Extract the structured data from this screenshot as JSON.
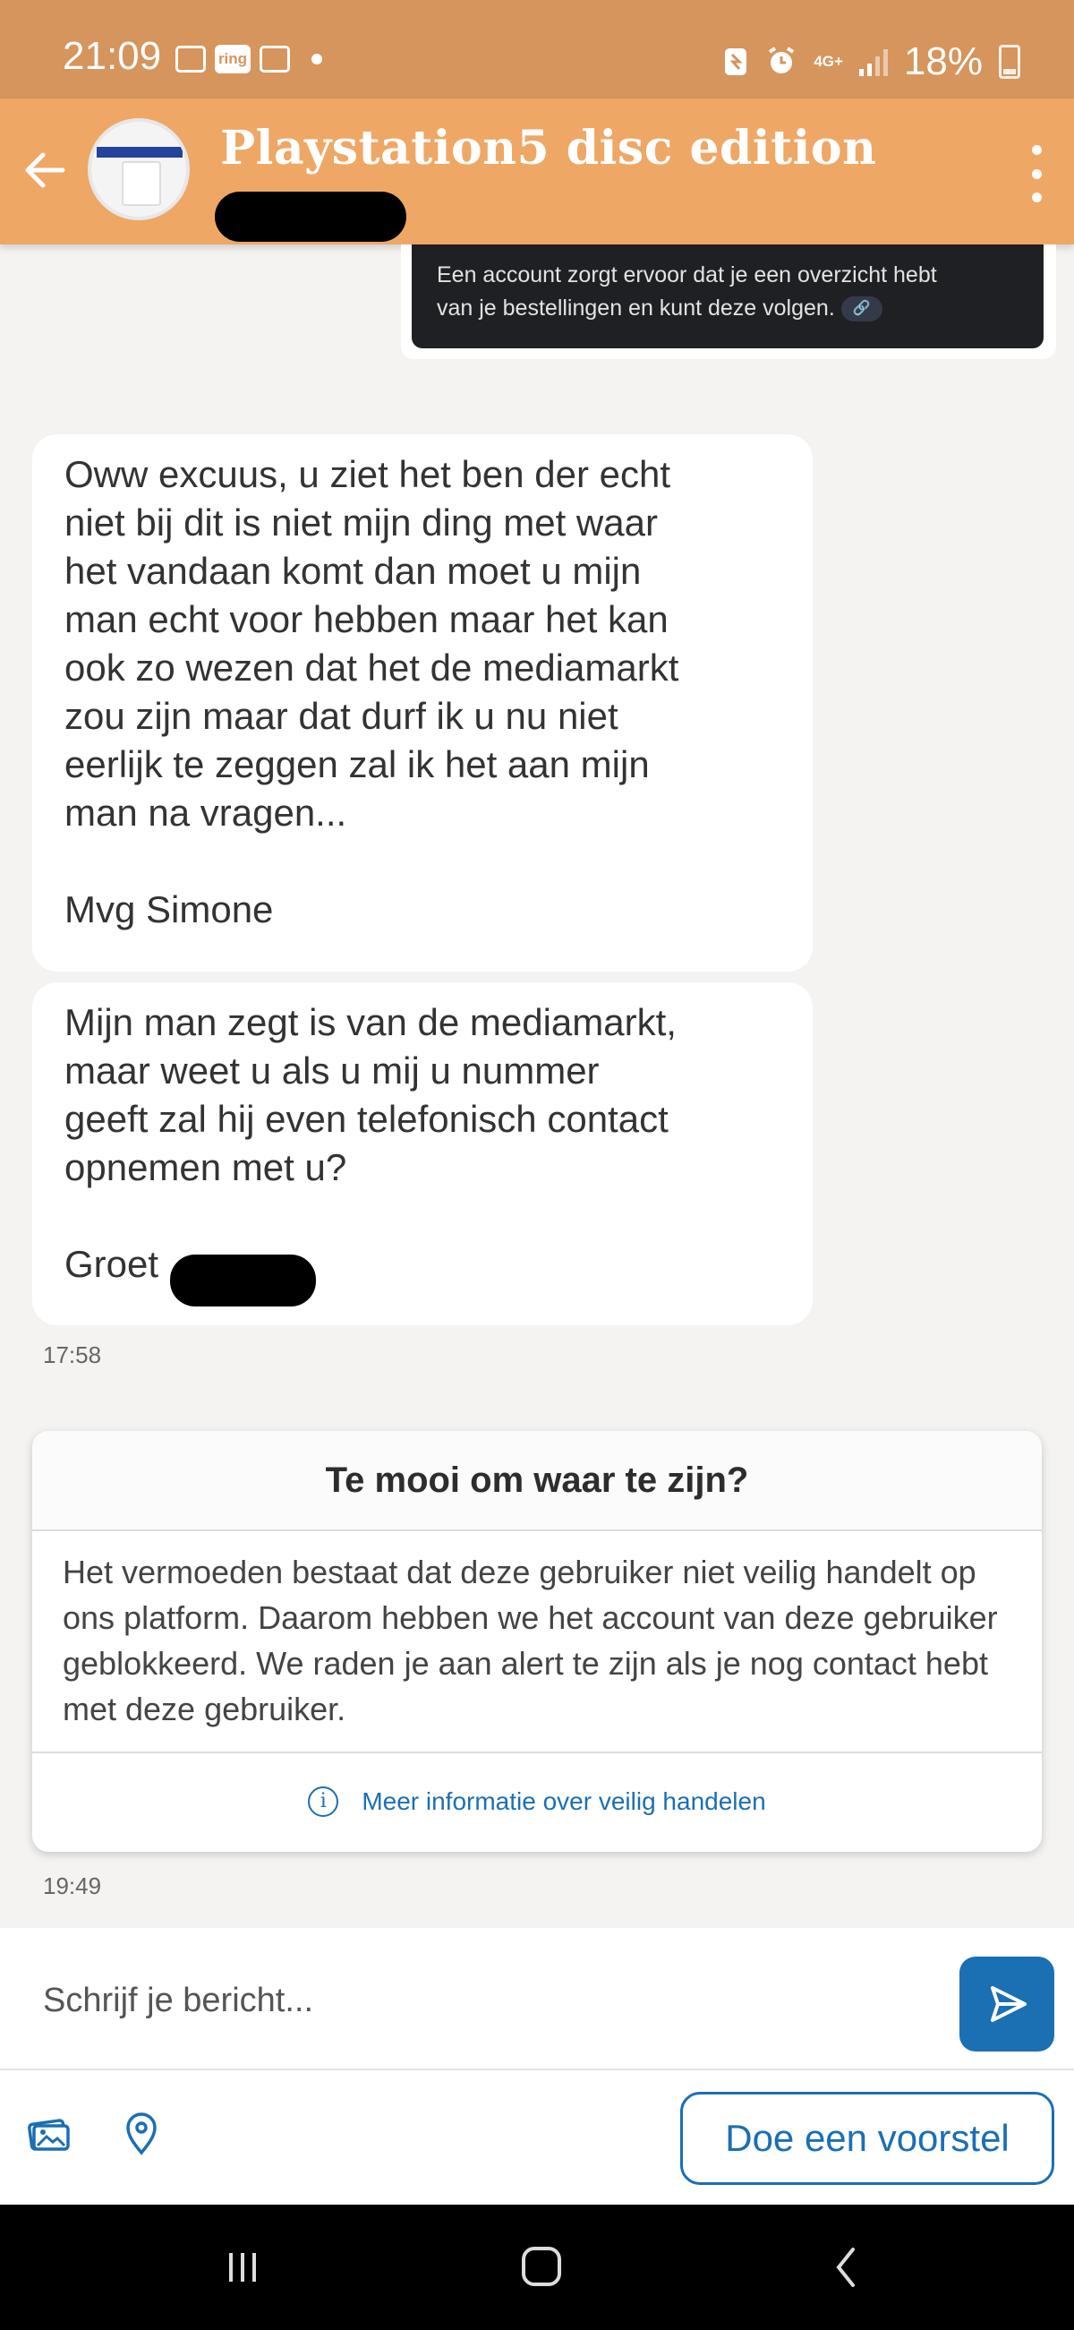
{
  "status_bar": {
    "time": "21:09",
    "left_icons": [
      "image-icon",
      "ring-icon",
      "mail-icon",
      "dot-icon"
    ],
    "ring_label": "ring",
    "network": "4G+",
    "battery": "18%",
    "right_icons": [
      "nfc-icon",
      "alarm-icon",
      "network-4g-icon",
      "signal-icon",
      "battery-icon"
    ]
  },
  "header": {
    "title": "Playstation5 disc edition",
    "back_icon": "arrow-left-icon",
    "menu_icon": "more-vertical-icon"
  },
  "conversation": {
    "own_message": {
      "text": "Een account zorgt ervoor dat je een overzicht hebt\nvan je bestellingen en kunt deze volgen."
    },
    "incoming": [
      {
        "text": "Oww excuus, u ziet het ben der echt\nniet bij dit is niet mijn ding met waar\nhet vandaan komt dan moet u mijn\nman echt voor hebben maar het kan\nook zo wezen dat het de mediamarkt\nzou zijn maar dat durf ik u nu niet\neerlijk te zeggen zal ik het aan mijn\nman na vragen...\n\nMvg Simone"
      },
      {
        "text": "Mijn man zegt is van de mediamarkt,\nmaar weet u als u mij u nummer\ngeeft zal hij even telefonisch contact\nopnemen met u?\n\nGroet"
      }
    ],
    "incoming_time": "17:58",
    "warning": {
      "title": "Te mooi om waar te zijn?",
      "body": "Het vermoeden bestaat dat deze gebruiker niet veilig handelt op ons platform. Daarom hebben we het account van deze gebruiker geblokkeerd. We raden je aan alert te zijn als je nog contact hebt met deze gebruiker.",
      "link": "Meer informatie over veilig handelen",
      "link_icon": "info-icon"
    },
    "warning_time": "19:49"
  },
  "composer": {
    "placeholder": "Schrijf je bericht...",
    "send_icon": "send-icon",
    "photo_icon": "photo-icon",
    "location_icon": "location-pin-icon",
    "offer_button": "Doe een voorstel"
  },
  "nav_bar": {
    "recents_icon": "recents-icon",
    "home_icon": "home-icon",
    "back_icon": "nav-back-icon"
  },
  "colors": {
    "status_bar": "#d5955d",
    "app_bar": "#efa766",
    "accent": "#1b6fb3",
    "background": "#f4f3f1"
  }
}
